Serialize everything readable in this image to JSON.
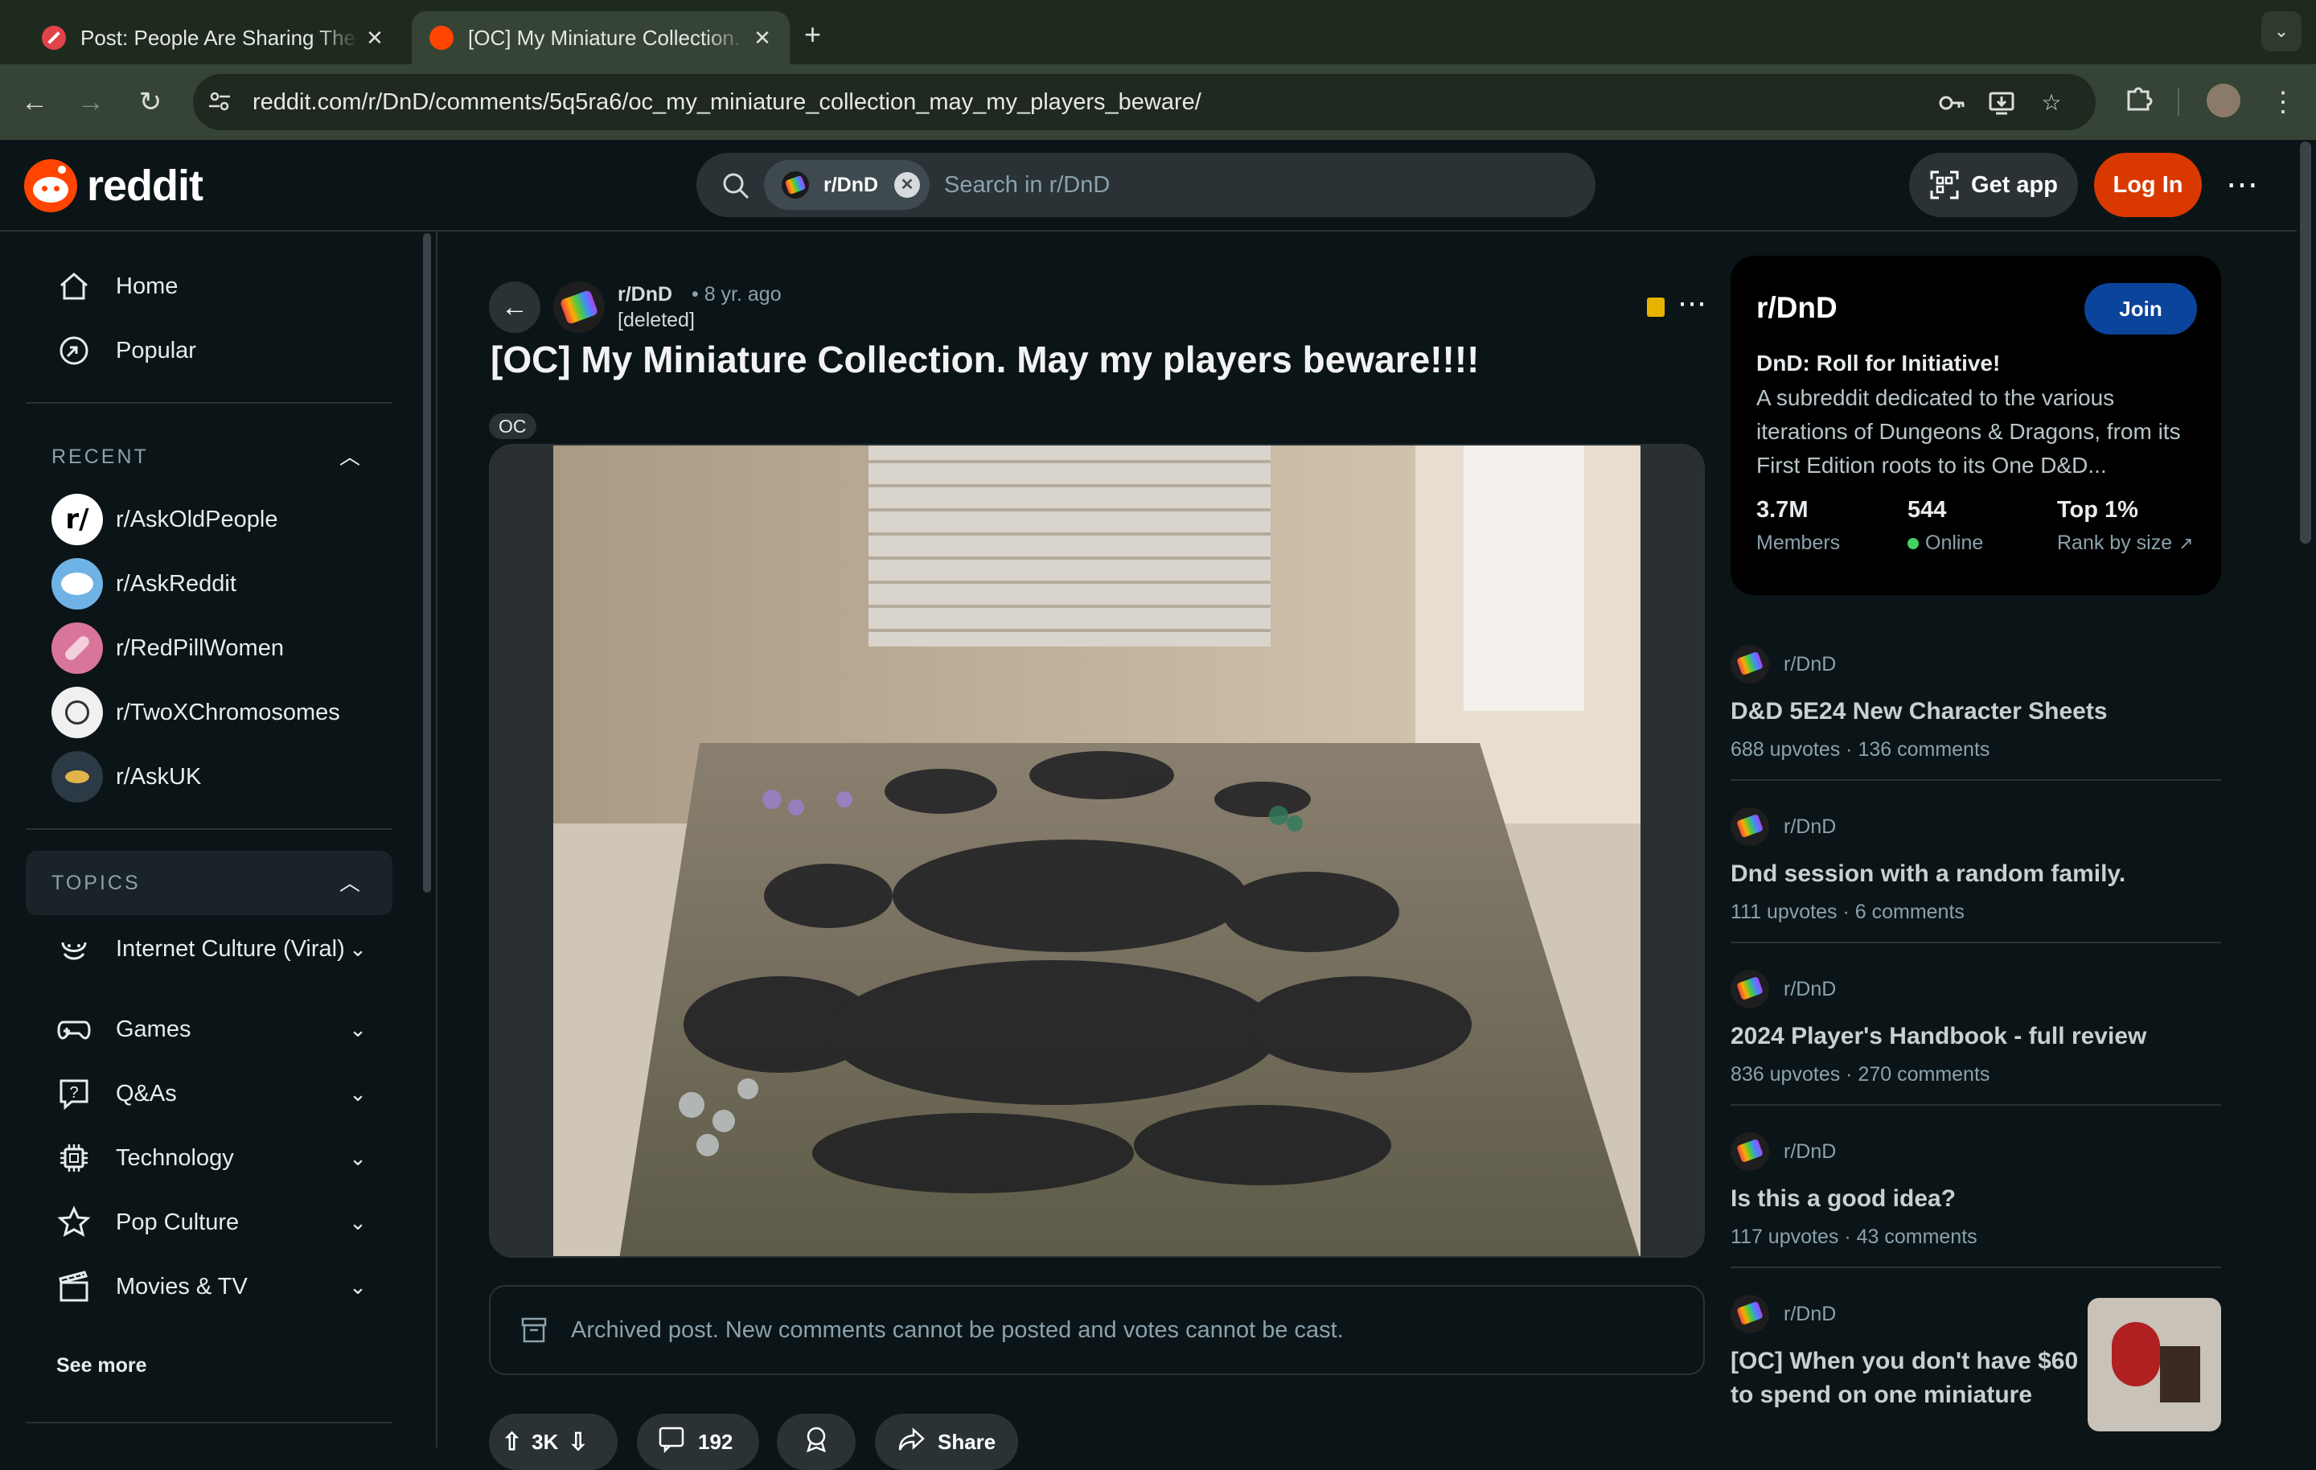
{
  "browser": {
    "tabs": [
      {
        "title": "Post: People Are Sharing The",
        "active": false
      },
      {
        "title": "[OC] My Miniature Collection.",
        "active": true
      }
    ],
    "url": "reddit.com/r/DnD/comments/5q5ra6/oc_my_miniature_collection_may_my_players_beware/"
  },
  "header": {
    "logo_text": "reddit",
    "search_chip": "r/DnD",
    "search_placeholder": "Search in r/DnD",
    "get_app": "Get app",
    "login": "Log In"
  },
  "sidebar": {
    "nav": [
      {
        "label": "Home",
        "icon": "home-icon"
      },
      {
        "label": "Popular",
        "icon": "popular-icon"
      }
    ],
    "recent_header": "RECENT",
    "recent": [
      {
        "label": "r/AskOldPeople",
        "color": "#ffffff",
        "glyph": "r/"
      },
      {
        "label": "r/AskReddit",
        "color": "#6fb3e6",
        "glyph": ""
      },
      {
        "label": "r/RedPillWomen",
        "color": "#d9759a",
        "glyph": ""
      },
      {
        "label": "r/TwoXChromosomes",
        "color": "#f0f0f0",
        "glyph": ""
      },
      {
        "label": "r/AskUK",
        "color": "#2b3a44",
        "glyph": ""
      }
    ],
    "topics_header": "TOPICS",
    "topics": [
      {
        "label": "Internet Culture (Viral)",
        "icon": "smile-icon"
      },
      {
        "label": "Games",
        "icon": "gamepad-icon"
      },
      {
        "label": "Q&As",
        "icon": "question-icon"
      },
      {
        "label": "Technology",
        "icon": "chip-icon"
      },
      {
        "label": "Pop Culture",
        "icon": "star-icon"
      },
      {
        "label": "Movies & TV",
        "icon": "clapper-icon"
      }
    ],
    "see_more": "See more"
  },
  "post": {
    "subreddit": "r/DnD",
    "age": "• 8 yr. ago",
    "author": "[deleted]",
    "title": "[OC] My Miniature Collection. May my players beware!!!!",
    "flair": "OC",
    "archived_notice": "Archived post. New comments cannot be posted and votes cannot be cast.",
    "votes": "3K",
    "comments": "192",
    "share": "Share"
  },
  "community": {
    "name": "r/DnD",
    "join": "Join",
    "tagline": "DnD: Roll for Initiative!",
    "description": "A subreddit dedicated to the various iterations of Dungeons & Dragons, from its First Edition roots to its One D&D...",
    "stats": [
      {
        "value": "3.7M",
        "label": "Members"
      },
      {
        "value": "544",
        "label": "Online"
      },
      {
        "value": "Top 1%",
        "label": "Rank by size"
      }
    ]
  },
  "related": [
    {
      "sub": "r/DnD",
      "title": "D&D 5E24 New Character Sheets",
      "upvotes": "688 upvotes",
      "comments": "136 comments"
    },
    {
      "sub": "r/DnD",
      "title": "Dnd session with a random family.",
      "upvotes": "111 upvotes",
      "comments": "6 comments"
    },
    {
      "sub": "r/DnD",
      "title": "2024 Player's Handbook - full review",
      "upvotes": "836 upvotes",
      "comments": "270 comments"
    },
    {
      "sub": "r/DnD",
      "title": "Is this a good idea?",
      "upvotes": "117 upvotes",
      "comments": "43 comments"
    },
    {
      "sub": "r/DnD",
      "title": "[OC] When you don't have $60 to spend on one miniature",
      "upvotes": "",
      "comments": ""
    }
  ],
  "colors": {
    "reddit_orange": "#ff4500",
    "login_button": "#d93900",
    "join_button": "#0a449b",
    "online_dot": "#46d160"
  }
}
